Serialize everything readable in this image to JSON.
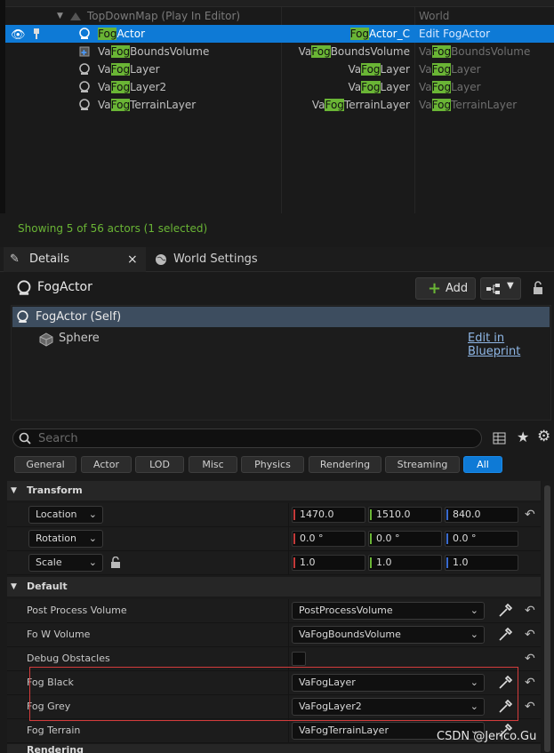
{
  "outliner": {
    "header": {
      "name": "TopDownMap (Play In Editor)",
      "right": "World"
    },
    "rows": [
      {
        "name_hl": "Fog",
        "name_rest": "Actor",
        "type_pre": "",
        "type_hl": "Fog",
        "type_rest": "Actor_C",
        "right_pre": "Edit ",
        "right_hl": "Fog",
        "right_rest": "Actor"
      },
      {
        "name_pre": "Va",
        "name_hl": "Fog",
        "name_rest": "BoundsVolume",
        "type_pre": "Va",
        "type_hl": "Fog",
        "type_rest": "BoundsVolume",
        "right_pre": "Va",
        "right_hl": "Fog",
        "right_rest": "BoundsVolume"
      },
      {
        "name_pre": "Va",
        "name_hl": "Fog",
        "name_rest": "Layer",
        "type_pre": "Va",
        "type_hl": "Fog",
        "type_rest": "Layer",
        "right_pre": "Va",
        "right_hl": "Fog",
        "right_rest": "Layer"
      },
      {
        "name_pre": "Va",
        "name_hl": "Fog",
        "name_rest": "Layer2",
        "type_pre": "Va",
        "type_hl": "Fog",
        "type_rest": "Layer",
        "right_pre": "Va",
        "right_hl": "Fog",
        "right_rest": "Layer"
      },
      {
        "name_pre": "Va",
        "name_hl": "Fog",
        "name_rest": "TerrainLayer",
        "type_pre": "Va",
        "type_hl": "Fog",
        "type_rest": "TerrainLayer",
        "right_pre": "Va",
        "right_hl": "Fog",
        "right_rest": "TerrainLayer"
      }
    ],
    "status": "Showing 5 of 56 actors (1 selected)"
  },
  "tabs": {
    "details": "Details",
    "world_settings": "World Settings",
    "close": "×"
  },
  "details": {
    "actor_name": "FogActor",
    "add_label": "Add",
    "components": {
      "self": "FogActor (Self)",
      "sphere": "Sphere",
      "edit_blueprint": "Edit in Blueprint"
    },
    "search_placeholder": "Search",
    "filters": [
      "General",
      "Actor",
      "LOD",
      "Misc",
      "Physics",
      "Rendering",
      "Streaming",
      "All"
    ],
    "transform": {
      "title": "Transform",
      "location": {
        "label": "Location",
        "x": "1470.0",
        "y": "1510.0",
        "z": "840.0"
      },
      "rotation": {
        "label": "Rotation",
        "x": "0.0 °",
        "y": "0.0 °",
        "z": "0.0 °"
      },
      "scale": {
        "label": "Scale",
        "x": "1.0",
        "y": "1.0",
        "z": "1.0"
      }
    },
    "default": {
      "title": "Default",
      "props": [
        {
          "label": "Post Process Volume",
          "value": "PostProcessVolume"
        },
        {
          "label": "Fo W Volume",
          "value": "VaFogBoundsVolume"
        },
        {
          "label": "Debug Obstacles",
          "value": ""
        },
        {
          "label": "Fog Black",
          "value": "VaFogLayer"
        },
        {
          "label": "Fog Grey",
          "value": "VaFogLayer2"
        },
        {
          "label": "Fog Terrain",
          "value": "VaFogTerrainLayer"
        }
      ]
    },
    "next_category": "Rendering"
  },
  "watermark": "CSDN @Jerico.Gu",
  "colors": {
    "selection": "#0e7ad6",
    "highlight": "#6ab535",
    "axis_x": "#c43a3a",
    "axis_y": "#6ab535",
    "axis_z": "#3a6bd0",
    "annotation": "#d43c3c"
  }
}
